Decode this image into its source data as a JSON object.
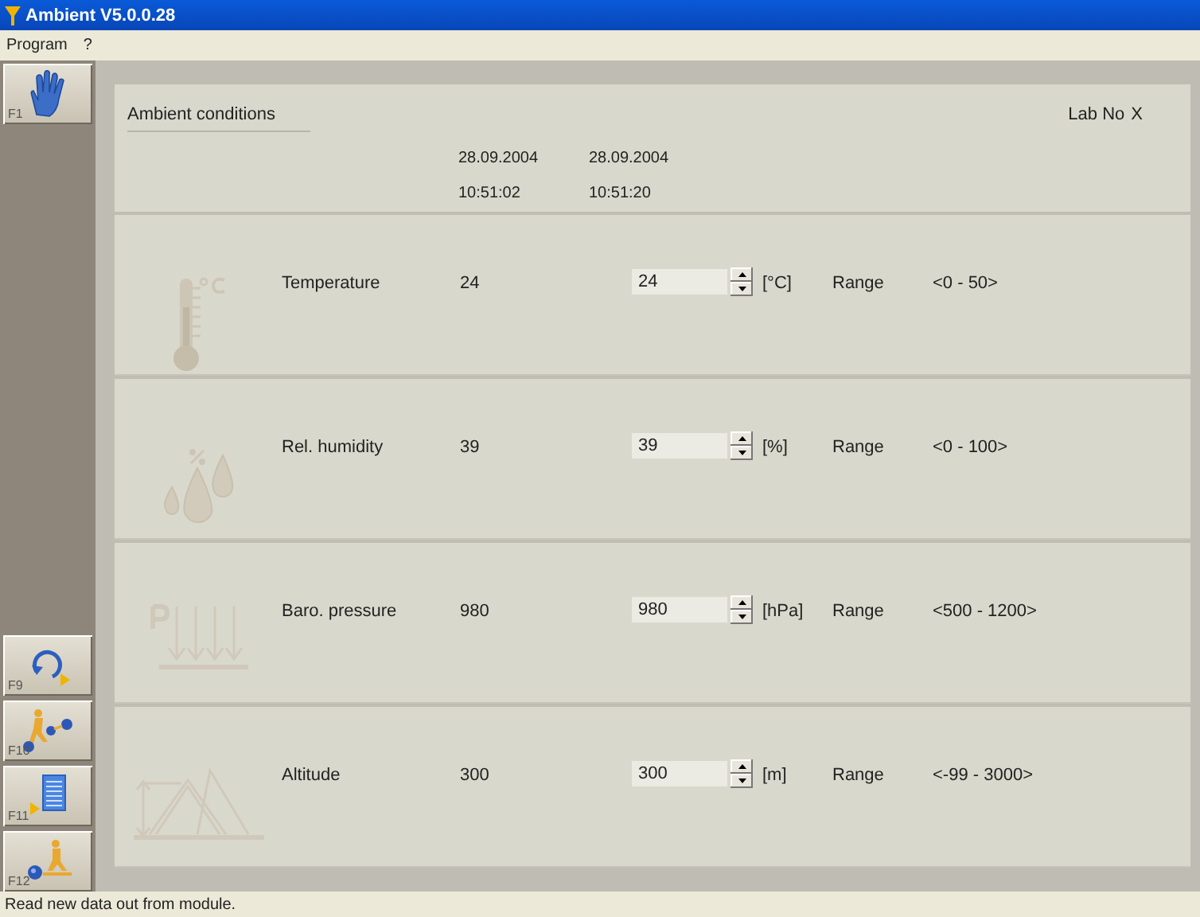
{
  "window": {
    "title": "Ambient V5.0.0.28"
  },
  "menu": [
    "Program",
    "?"
  ],
  "sidebar": {
    "top": [
      {
        "key": "F1",
        "kind": "hand"
      }
    ],
    "bottom": [
      {
        "key": "F9",
        "kind": "refresh"
      },
      {
        "key": "F10",
        "kind": "transfer"
      },
      {
        "key": "F11",
        "kind": "list"
      },
      {
        "key": "F12",
        "kind": "send"
      }
    ]
  },
  "header": {
    "title": "Ambient conditions",
    "lab_no": "Lab No",
    "close": "X",
    "columns": [
      {
        "date": "28.09.2004",
        "time": "10:51:02"
      },
      {
        "date": "28.09.2004",
        "time": "10:51:20"
      }
    ]
  },
  "rows": [
    {
      "kind": "temperature",
      "label": "Temperature",
      "reading": "24",
      "value": "24",
      "unit": "[°C]",
      "range_label": "Range",
      "range": "<0 - 50>"
    },
    {
      "kind": "humidity",
      "label": "Rel. humidity",
      "reading": "39",
      "value": "39",
      "unit": "[%]",
      "range_label": "Range",
      "range": "<0 - 100>"
    },
    {
      "kind": "pressure",
      "label": "Baro. pressure",
      "reading": "980",
      "value": "980",
      "unit": "[hPa]",
      "range_label": "Range",
      "range": "<500 - 1200>"
    },
    {
      "kind": "altitude",
      "label": "Altitude",
      "reading": "300",
      "value": "300",
      "unit": "[m]",
      "range_label": "Range",
      "range": "<-99 - 3000>"
    }
  ],
  "status_bar": "Read new data out from module."
}
